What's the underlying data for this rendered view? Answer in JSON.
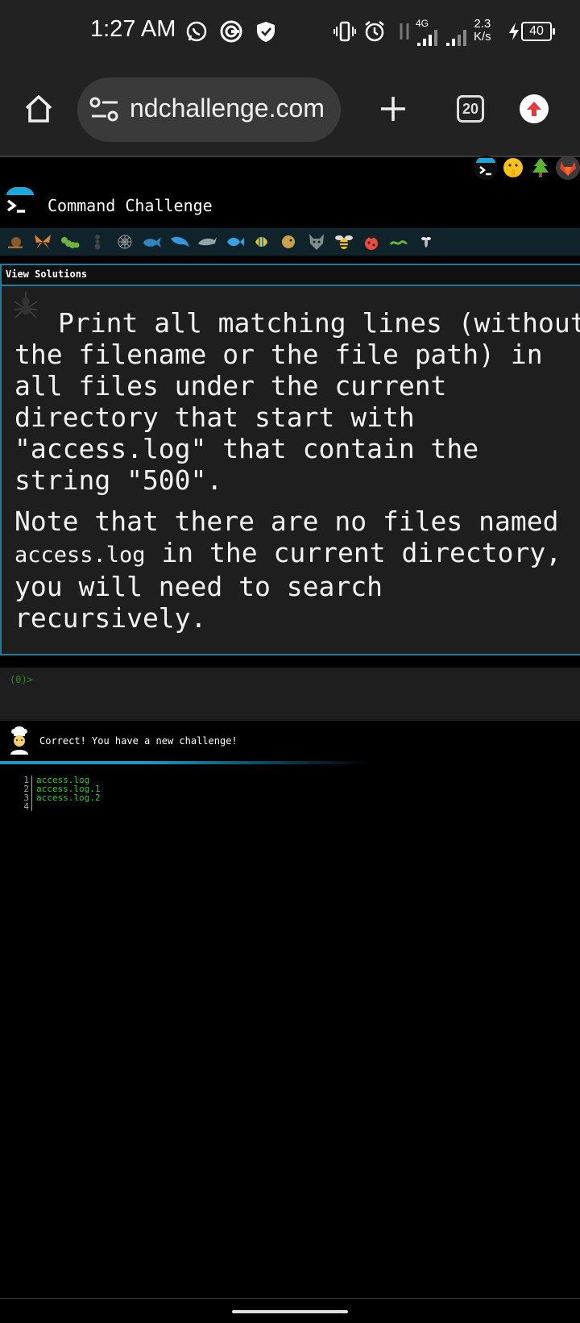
{
  "status_bar": {
    "time": "1:27 AM",
    "network_type": "4G",
    "network_speed_value": "2.3",
    "network_speed_unit": "K/s",
    "battery": "40"
  },
  "browser": {
    "url": "ndchallenge.com",
    "tab_count": "20"
  },
  "site": {
    "title": "Command Challenge"
  },
  "panel": {
    "view_solutions": "View Solutions",
    "challenge_text": "Print all matching lines (without the filename or the file path) in all files under the current directory that start with \"access.log\" that contain the string \"500\".",
    "note_prefix": "Note that there are no files named",
    "note_code": "access.log",
    "note_suffix": "in the current directory, you will need to search recursively."
  },
  "terminal": {
    "prompt": "(0)>"
  },
  "feedback": {
    "message": "Correct! You have a new challenge!"
  },
  "output": {
    "lines": [
      {
        "num": "1",
        "text": "access.log"
      },
      {
        "num": "2",
        "text": "access.log.1"
      },
      {
        "num": "3",
        "text": "access.log.2"
      },
      {
        "num": "4",
        "text": ""
      }
    ]
  },
  "colors": {
    "accent": "#1a9bc8",
    "terminal_green": "#1fd51f",
    "panel_bg": "#1e1e1e",
    "chrome_bg": "#222222"
  }
}
